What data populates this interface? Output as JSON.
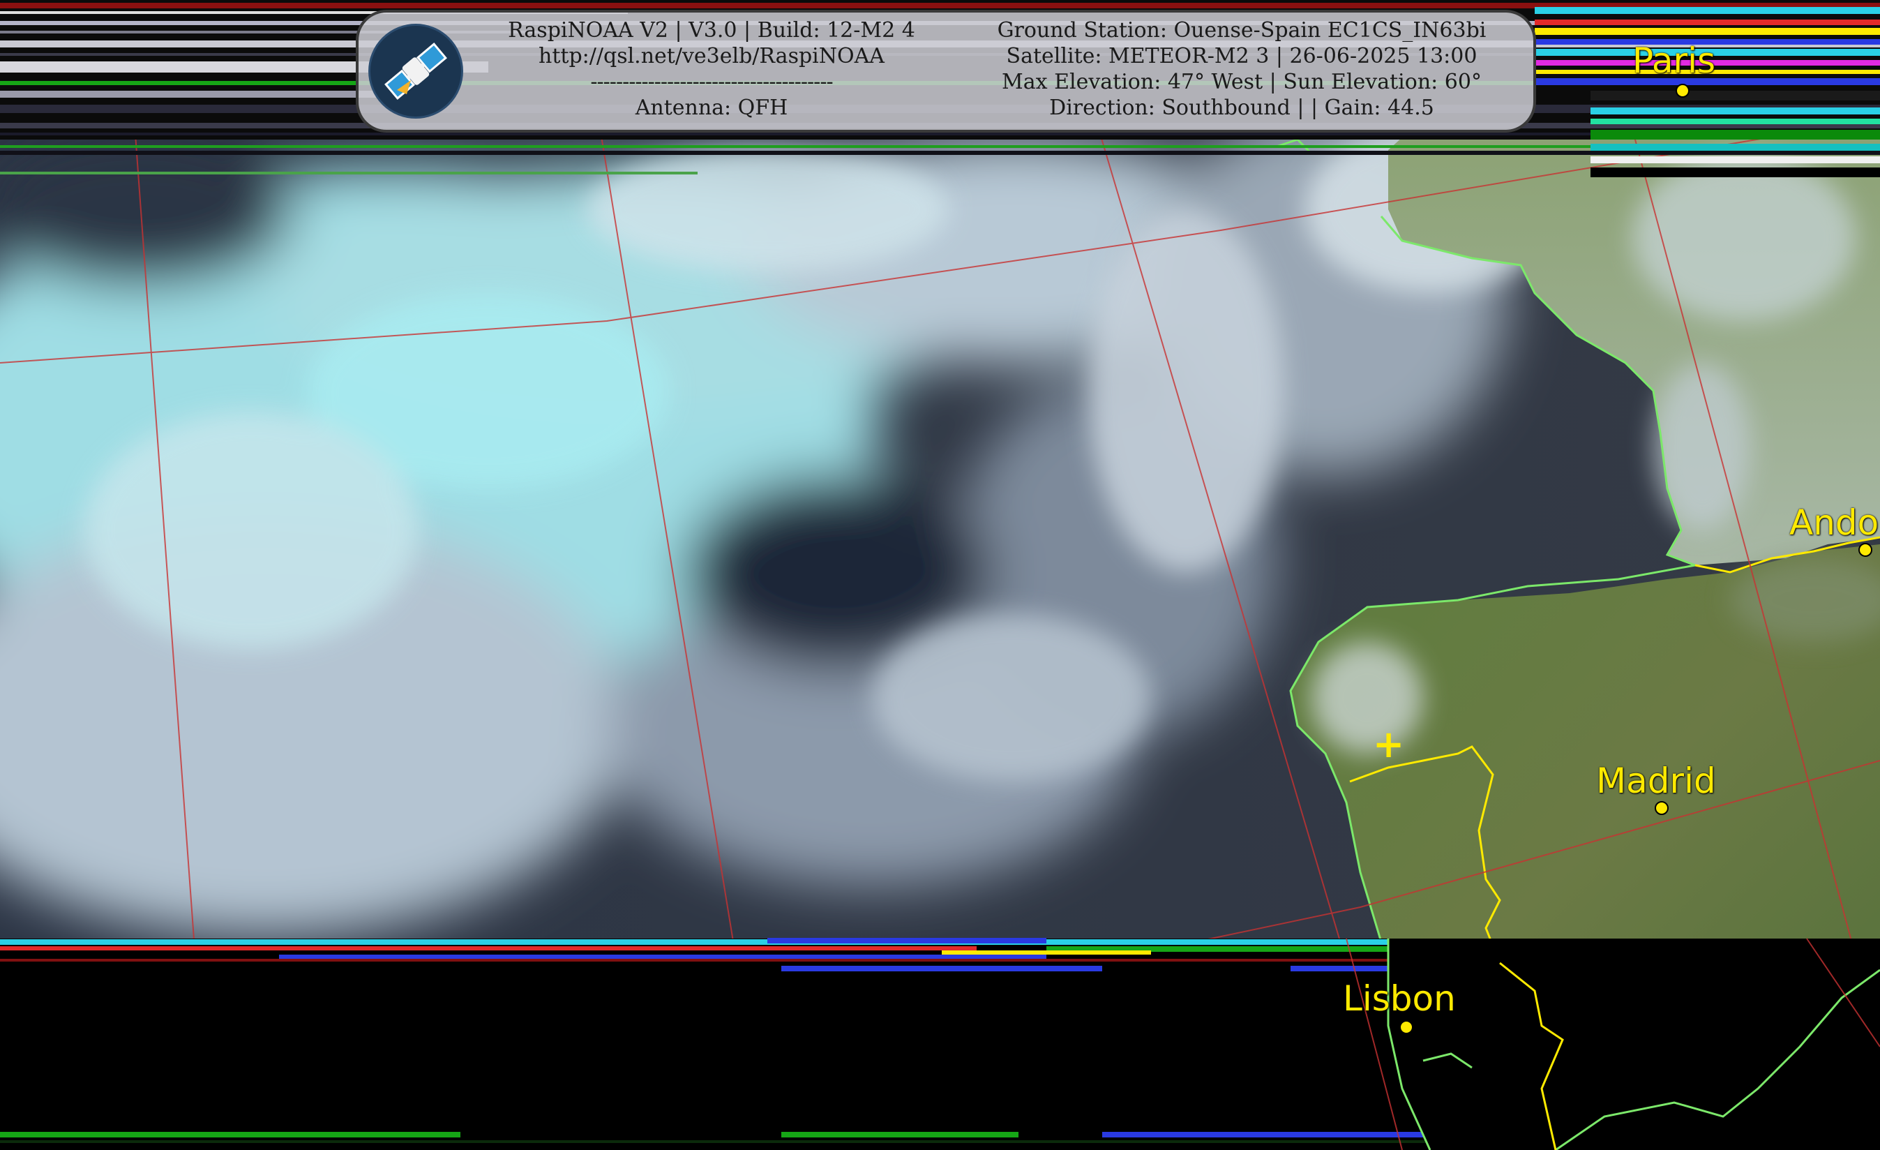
{
  "header": {
    "app_line": "RaspiNOAA V2 | V3.0 | Build: 12-M2 4",
    "url": "http://qsl.net/ve3elb/RaspiNOAA",
    "separator": "--------------------------------------",
    "antenna": "Antenna: QFH",
    "ground_station": "Ground Station: Ouense-Spain EC1CS_IN63bi",
    "satellite": "Satellite: METEOR-M2 3 | 26-06-2025 13:00",
    "elevation": "Max Elevation: 47° West | Sun Elevation: 60°",
    "direction": "Direction: Southbound | | Gain: 44.5"
  },
  "icons": {
    "logo": "satellite-icon",
    "station": "plus-marker-icon"
  },
  "cities": [
    {
      "name": "Paris"
    },
    {
      "name": "Ando"
    },
    {
      "name": "Madrid"
    },
    {
      "name": "Lisbon"
    }
  ],
  "colors": {
    "label": "#ffea00",
    "coastline": "#7ce86a",
    "border": "#ffea00",
    "graticule": "#c83232"
  }
}
